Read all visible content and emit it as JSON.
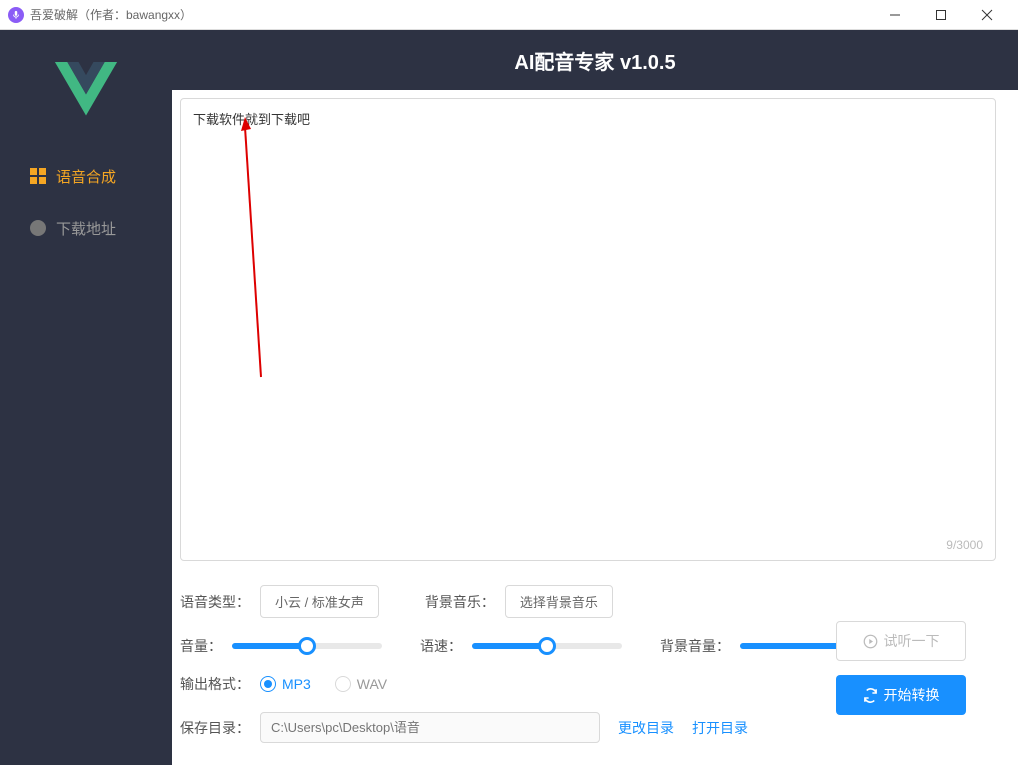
{
  "titlebar": {
    "text": "吾爱破解（作者：bawangxx）"
  },
  "header": {
    "title": "AI配音专家 v1.0.5"
  },
  "sidebar": {
    "items": [
      {
        "label": "语音合成",
        "active": true
      },
      {
        "label": "下载地址",
        "active": false
      }
    ]
  },
  "textarea": {
    "value": "下载软件就到下载吧",
    "counter": "9/3000"
  },
  "controls": {
    "voice_type": {
      "label": "语音类型：",
      "value": "小云 / 标准女声"
    },
    "bg_music": {
      "label": "背景音乐：",
      "value": "选择背景音乐"
    },
    "volume": {
      "label": "音量：",
      "percent": 50
    },
    "speed": {
      "label": "语速：",
      "percent": 50
    },
    "bg_volume": {
      "label": "背景音量：",
      "percent": 70
    },
    "output_format": {
      "label": "输出格式：",
      "options": [
        {
          "label": "MP3",
          "checked": true
        },
        {
          "label": "WAV",
          "checked": false
        }
      ]
    },
    "save_dir": {
      "label": "保存目录：",
      "placeholder": "C:\\Users\\pc\\Desktop\\语音",
      "change_label": "更改目录",
      "open_label": "打开目录"
    }
  },
  "actions": {
    "preview": "试听一下",
    "convert": "开始转换"
  }
}
